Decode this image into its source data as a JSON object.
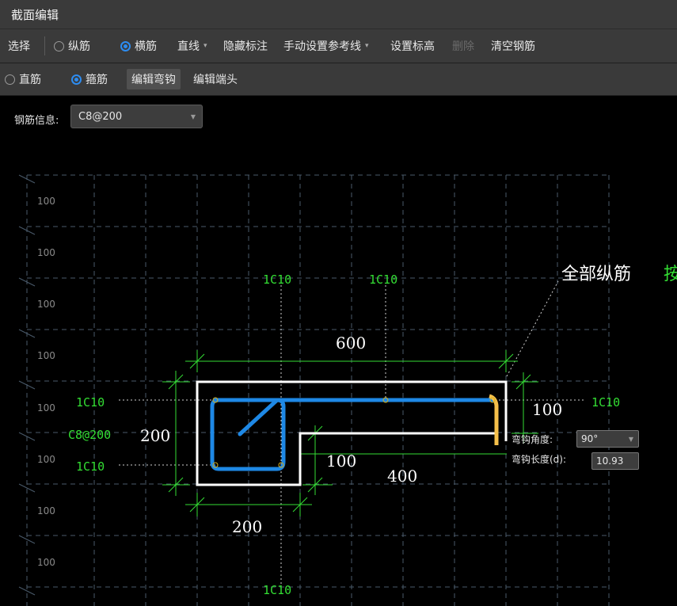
{
  "window": {
    "title": "截面编辑"
  },
  "toolbar1": {
    "select": "选择",
    "longitudinal": "纵筋",
    "transverse": "横筋",
    "line": "直线",
    "hide_annotation": "隐藏标注",
    "manual_ref_line": "手动设置参考线",
    "set_elevation": "设置标高",
    "delete": "删除",
    "clear_rebar": "清空钢筋"
  },
  "toolbar2": {
    "straight": "直筋",
    "stirrup": "箍筋",
    "edit_hook": "编辑弯钩",
    "edit_end": "编辑端头"
  },
  "rebar_info": {
    "label": "钢筋信息:",
    "value": "C8@200"
  },
  "canvas": {
    "row_labels": [
      "100",
      "100",
      "100",
      "100",
      "100",
      "100",
      "100",
      "100"
    ],
    "rebar_labels": {
      "top_left": "1C10",
      "top_middle": "1C10",
      "left_top": "1C10",
      "left_stirrup": "C8@200",
      "left_bottom": "1C10",
      "right": "1C10",
      "bottom": "1C10"
    },
    "dimensions": {
      "top_width": "600",
      "left_height": "200",
      "right_top": "100",
      "step_height": "100",
      "bottom_right": "400",
      "bottom_left": "200"
    },
    "all_rebar_text": "全部纵筋",
    "truncated_text": "按"
  },
  "hook_editor": {
    "angle_label": "弯钩角度:",
    "angle_value": "90°",
    "length_label": "弯钩长度(d):",
    "length_value": "10.93"
  },
  "colors": {
    "green": "#33dd33",
    "rebar_blue": "#1e88e5",
    "hook_yellow": "#f5c04a",
    "section_white": "#ffffff"
  }
}
